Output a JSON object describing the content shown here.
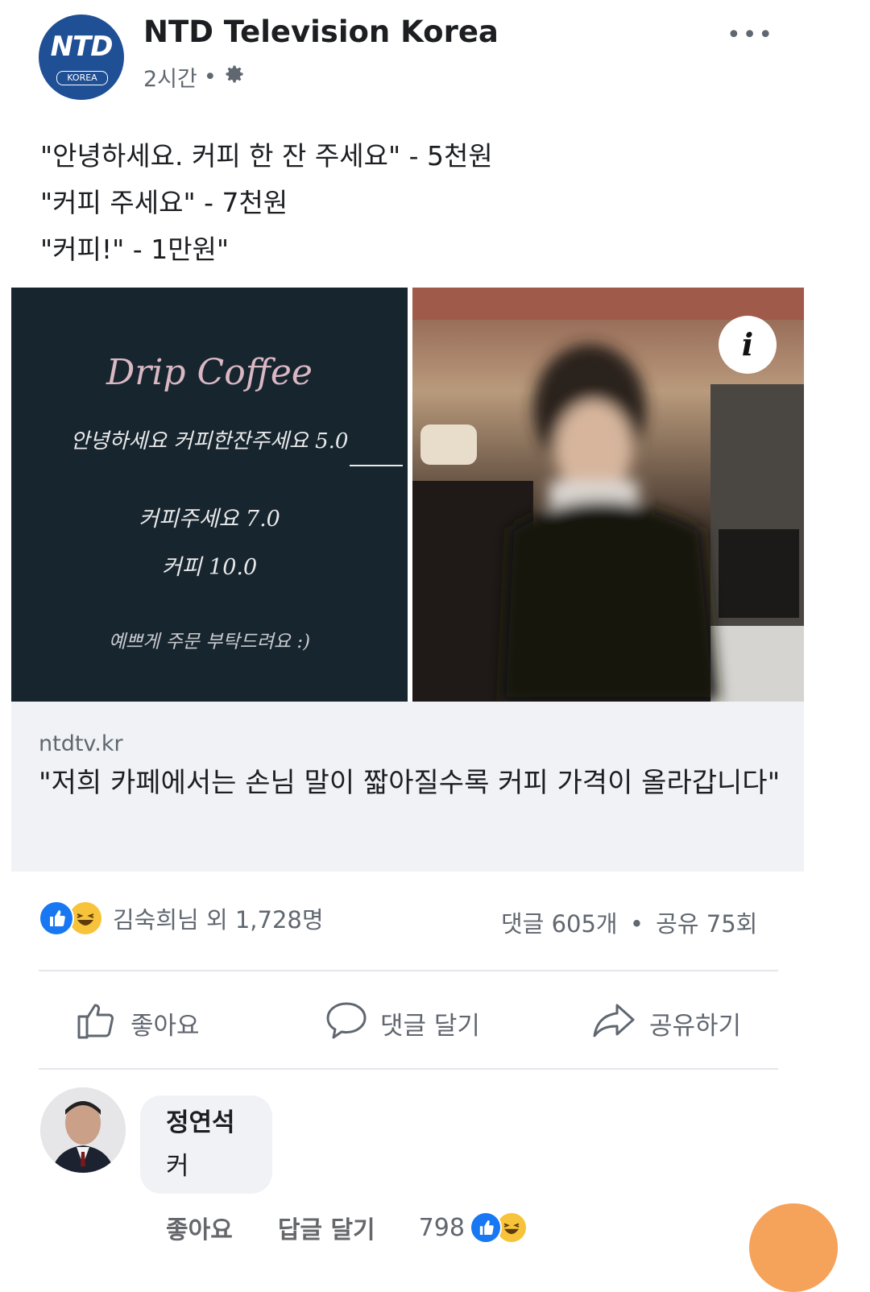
{
  "post": {
    "page_name": "NTD Television Korea",
    "time": "2시간",
    "privacy_icon": "gear-icon",
    "more_label": "•••",
    "avatar_logo_text": "NTD",
    "avatar_logo_sub": "KOREA",
    "text_lines": [
      "\"안녕하세요. 커피 한 잔 주세요\" - 5천원",
      "\"커피 주세요\" - 7천원",
      "\"커피!\" - 1만원\""
    ]
  },
  "image": {
    "chalkboard": {
      "title": "Drip Coffee",
      "line1": "안녕하세요 커피한잔주세요 5.0",
      "line2": "커피주세요 7.0",
      "line3": "커피 10.0",
      "line4": "예쁘게 주문 부탁드려요 :)"
    },
    "info_label": "i"
  },
  "link": {
    "domain": "ntdtv.kr",
    "title": "\"저희 카페에서는 손님 말이 짧아질수록 커피 가격이 올라갑니다\""
  },
  "reactions": {
    "summary": "김숙희님 외 1,728명",
    "comments": "댓글 605개",
    "shares": "공유 75회",
    "separator": "•"
  },
  "actions": {
    "like": "좋아요",
    "comment": "댓글 달기",
    "share": "공유하기"
  },
  "comment": {
    "author": "정연석",
    "text": "커",
    "like": "좋아요",
    "reply": "답글 달기",
    "reaction_count": "798"
  },
  "colors": {
    "facebook_blue": "#1877f2",
    "ntd_blue": "#1f4f94",
    "text_secondary": "#606770"
  }
}
